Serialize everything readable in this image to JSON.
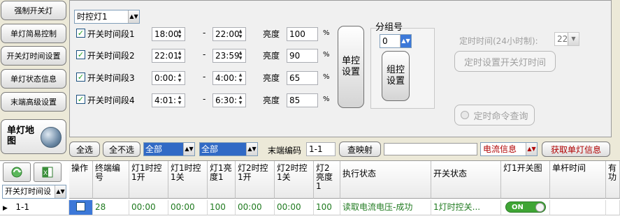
{
  "sidebar": {
    "items": [
      {
        "label": "强制开关灯"
      },
      {
        "label": "单灯简易控制"
      },
      {
        "label": "开关灯时间设置"
      },
      {
        "label": "单灯状态信息"
      },
      {
        "label": "末端高级设置"
      }
    ],
    "map_label": "单灯地图"
  },
  "panel": {
    "mode_select": "时控灯1",
    "segments": [
      {
        "label": "开关时间段1",
        "checked": true,
        "on": "18:00:",
        "off": "22:00:",
        "brightness": "100"
      },
      {
        "label": "开关时间段2",
        "checked": true,
        "on": "22:01:",
        "off": "23:59:",
        "brightness": "90"
      },
      {
        "label": "开关时间段3",
        "checked": true,
        "on": "0:00:",
        "off": "4:00:",
        "brightness": "65"
      },
      {
        "label": "开关时间段4",
        "checked": true,
        "on": "4:01:",
        "off": "6:30:",
        "brightness": "85"
      }
    ],
    "dash": "-",
    "brightness_label": "亮度",
    "percent": "%",
    "single_set": "单控\n设置",
    "group_label": "分组号",
    "group_value": "0",
    "group_set": "组控\n设置",
    "timer_label": "定时时间(24小时制):",
    "timer_value": "22",
    "timer_set": "定时设置开关灯时间",
    "timer_query": "定时命令查询"
  },
  "filter": {
    "select_all": "全选",
    "select_none": "全不选",
    "combo1": "全部",
    "combo2": "全部",
    "terminal_label": "末端编码",
    "terminal_value": "1-1",
    "map_query": "查映射",
    "info_select": "电流信息",
    "fetch": "获取单灯信息"
  },
  "table": {
    "view_select": "开关灯时间设",
    "headers": [
      "操作",
      "终端编号",
      "灯1时控1开",
      "灯1时控1关",
      "灯1亮度1",
      "灯2时控1开",
      "灯2时控1关",
      "灯2亮度1",
      "执行状态",
      "开关状态",
      "灯1开关图",
      "单杆时间",
      "有功"
    ],
    "rows": [
      {
        "id": "1-1",
        "terminal": "28",
        "l1_on": "00:00",
        "l1_off": "00:00",
        "l1_br": "100",
        "l2_on": "00:00",
        "l2_off": "00:00",
        "l2_br": "100",
        "exec": "读取电流电压-成功",
        "switch": "1灯时控关...",
        "toggle": "ON"
      }
    ]
  },
  "colors": {
    "accent_blue": "#316ac5",
    "green_text": "#1f7a1f",
    "toggle_green": "#3fa535",
    "red_text": "#b00000"
  }
}
